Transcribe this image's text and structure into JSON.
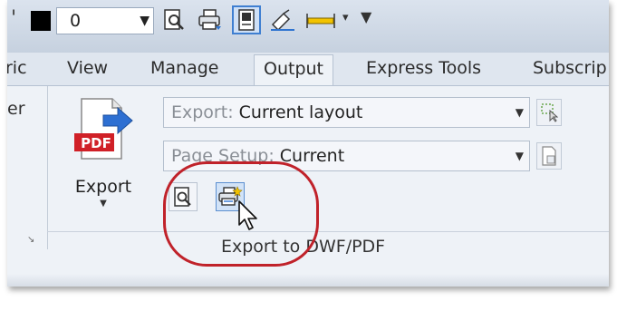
{
  "toolbar": {
    "layer_value": "0",
    "colors": {
      "accent": "#3f7fd1",
      "highlight": "#c0222a"
    }
  },
  "tabs": [
    {
      "label": "ric",
      "active": false
    },
    {
      "label": "View",
      "active": false
    },
    {
      "label": "Manage",
      "active": false
    },
    {
      "label": "Output",
      "active": true
    },
    {
      "label": "Express Tools",
      "active": false
    },
    {
      "label": "Subscrip",
      "active": false
    }
  ],
  "panel": {
    "left_fragment": "er",
    "export_button": {
      "icon_text": "PDF",
      "label": "Export"
    },
    "export_dropdown": {
      "prefix": "Export:",
      "value": "Current layout"
    },
    "pagesetup_dropdown": {
      "prefix": "Page Setup:",
      "value": "Current"
    },
    "group_label": "Export to DWF/PDF"
  },
  "icons": {
    "qat": [
      "plot-preview-icon",
      "plot-icon",
      "layout-icon",
      "publish-icon",
      "measure-icon"
    ],
    "panel": [
      "preview-icon",
      "export-dwf-pdf-options-icon"
    ]
  }
}
